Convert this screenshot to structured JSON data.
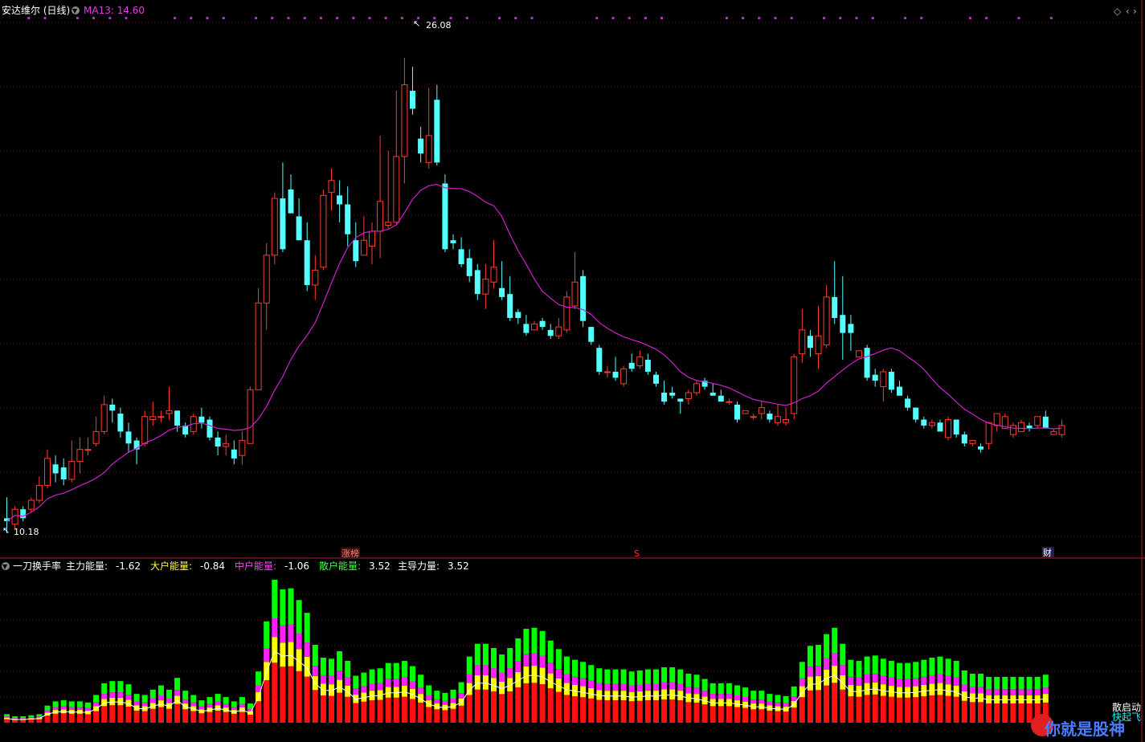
{
  "header": {
    "stock_title": "安达维尔 (日线)",
    "ma_label": "MA13: 14.60",
    "max_price_label": "26.08",
    "min_price_label": "10.18"
  },
  "markers": {
    "limit_up_tag": "涨榜",
    "s_tag": "S",
    "finance_tag": "财"
  },
  "sub_header": {
    "indicator_name": "一刀换手率",
    "items": [
      {
        "label": "主力能量:",
        "value": "-1.62",
        "color": "#ffffff"
      },
      {
        "label": "大户能量:",
        "value": "-0.84",
        "color": "#ffff40"
      },
      {
        "label": "中户能量:",
        "value": "-1.06",
        "color": "#ff40ff"
      },
      {
        "label": "散户能量:",
        "value": "3.52",
        "color": "#40ff40"
      },
      {
        "label": "主导力量:",
        "value": "3.52",
        "color": "#ffffff"
      }
    ]
  },
  "side_labels": [
    "散启动",
    "快起飞"
  ],
  "watermark": "你就是股神",
  "colors": {
    "up": "#ff3b2e",
    "down": "#54ffff",
    "ma": "#d020d0",
    "energy_red": "#ff1010",
    "energy_yellow": "#ffff00",
    "energy_magenta": "#ff20ff",
    "energy_green": "#00ff00"
  },
  "chart_data": [
    {
      "type": "candlestick",
      "title": "安达维尔 (日线)",
      "ylim": [
        9.5,
        27.5
      ],
      "candles": [
        [
          10.7,
          11.4,
          10.2,
          10.6
        ],
        [
          10.5,
          11.1,
          10.3,
          11.0
        ],
        [
          11.0,
          11.1,
          10.6,
          10.7
        ],
        [
          11.0,
          11.4,
          10.9,
          11.3
        ],
        [
          11.3,
          12.1,
          11.2,
          11.8
        ],
        [
          11.8,
          13.0,
          11.7,
          12.7
        ],
        [
          12.5,
          12.8,
          11.9,
          12.2
        ],
        [
          12.4,
          12.7,
          11.8,
          12.0
        ],
        [
          12.0,
          13.3,
          11.9,
          12.6
        ],
        [
          12.6,
          13.4,
          12.2,
          13.0
        ],
        [
          13.0,
          13.4,
          12.8,
          13.0
        ],
        [
          13.2,
          14.1,
          13.1,
          13.6
        ],
        [
          13.6,
          14.8,
          13.5,
          14.5
        ],
        [
          14.5,
          14.7,
          13.9,
          14.3
        ],
        [
          14.2,
          14.4,
          13.4,
          13.6
        ],
        [
          13.6,
          13.9,
          12.9,
          13.2
        ],
        [
          13.3,
          13.4,
          12.5,
          13.0
        ],
        [
          13.2,
          14.3,
          13.1,
          14.1
        ],
        [
          14.0,
          14.6,
          13.8,
          14.1
        ],
        [
          14.1,
          14.3,
          13.9,
          14.1
        ],
        [
          14.2,
          15.1,
          14.0,
          14.3
        ],
        [
          14.3,
          14.3,
          13.6,
          13.8
        ],
        [
          13.8,
          13.9,
          13.4,
          13.5
        ],
        [
          13.6,
          14.2,
          13.5,
          14.1
        ],
        [
          14.1,
          14.4,
          13.7,
          13.9
        ],
        [
          14.0,
          14.1,
          13.3,
          13.4
        ],
        [
          13.4,
          13.6,
          12.8,
          13.1
        ],
        [
          13.1,
          13.5,
          12.8,
          13.2
        ],
        [
          13.0,
          13.3,
          12.5,
          12.7
        ],
        [
          12.8,
          13.6,
          12.5,
          13.3
        ],
        [
          13.2,
          15.1,
          13.2,
          15.0
        ],
        [
          15.0,
          18.4,
          15.0,
          17.9
        ],
        [
          17.9,
          19.9,
          17.0,
          19.5
        ],
        [
          19.5,
          21.6,
          19.2,
          21.4
        ],
        [
          21.4,
          22.6,
          19.6,
          19.7
        ],
        [
          21.7,
          22.2,
          20.9,
          20.9
        ],
        [
          20.8,
          21.4,
          20.0,
          20.0
        ],
        [
          20.0,
          20.6,
          18.3,
          18.5
        ],
        [
          18.5,
          19.5,
          18.0,
          19.0
        ],
        [
          19.1,
          21.7,
          19.0,
          21.5
        ],
        [
          21.6,
          22.4,
          21.0,
          22.0
        ],
        [
          21.5,
          22.0,
          20.6,
          21.2
        ],
        [
          21.2,
          21.8,
          19.8,
          20.2
        ],
        [
          20.0,
          20.6,
          19.1,
          19.3
        ],
        [
          19.5,
          20.8,
          19.5,
          20.0
        ],
        [
          19.8,
          20.6,
          19.2,
          20.3
        ],
        [
          20.3,
          23.5,
          19.4,
          21.3
        ],
        [
          20.5,
          23.0,
          20.4,
          20.6
        ],
        [
          20.6,
          25.0,
          20.5,
          22.8
        ],
        [
          22.8,
          26.1,
          21.9,
          25.2
        ],
        [
          25.0,
          25.8,
          24.2,
          24.4
        ],
        [
          23.4,
          23.8,
          22.6,
          22.9
        ],
        [
          22.6,
          25.1,
          22.4,
          23.5
        ],
        [
          24.7,
          25.2,
          22.5,
          22.6
        ],
        [
          21.9,
          22.2,
          19.6,
          19.7
        ],
        [
          20.0,
          20.2,
          19.7,
          19.9
        ],
        [
          19.7,
          20.1,
          19.1,
          19.2
        ],
        [
          19.4,
          19.7,
          18.6,
          18.8
        ],
        [
          19.0,
          19.2,
          18.0,
          18.2
        ],
        [
          18.2,
          19.2,
          17.7,
          18.7
        ],
        [
          18.6,
          20.0,
          18.4,
          19.1
        ],
        [
          18.4,
          19.3,
          18.0,
          18.1
        ],
        [
          18.2,
          18.8,
          17.3,
          17.4
        ],
        [
          17.6,
          17.7,
          17.2,
          17.4
        ],
        [
          17.2,
          17.5,
          16.8,
          16.9
        ],
        [
          17.0,
          17.3,
          17.0,
          17.2
        ],
        [
          17.3,
          17.4,
          17.0,
          17.1
        ],
        [
          17.0,
          17.2,
          16.7,
          16.8
        ],
        [
          16.8,
          17.4,
          16.7,
          17.1
        ],
        [
          17.0,
          18.3,
          16.9,
          18.1
        ],
        [
          17.8,
          19.6,
          17.7,
          18.6
        ],
        [
          18.8,
          19.0,
          17.1,
          17.3
        ],
        [
          17.1,
          17.1,
          16.5,
          16.6
        ],
        [
          16.4,
          16.5,
          15.5,
          15.6
        ],
        [
          15.6,
          15.8,
          15.4,
          15.6
        ],
        [
          15.6,
          16.1,
          15.3,
          15.4
        ],
        [
          15.2,
          15.8,
          15.1,
          15.7
        ],
        [
          15.9,
          16.2,
          15.6,
          15.7
        ],
        [
          15.8,
          16.3,
          15.7,
          16.1
        ],
        [
          16.0,
          16.2,
          15.5,
          15.6
        ],
        [
          15.5,
          15.6,
          15.1,
          15.2
        ],
        [
          14.9,
          15.3,
          14.5,
          14.6
        ],
        [
          14.9,
          15.1,
          14.7,
          14.8
        ],
        [
          14.7,
          14.7,
          14.2,
          14.6
        ],
        [
          14.7,
          15.0,
          14.5,
          14.9
        ],
        [
          14.9,
          15.3,
          14.8,
          15.2
        ],
        [
          15.3,
          15.4,
          15.0,
          15.1
        ],
        [
          14.9,
          15.2,
          14.8,
          14.8
        ],
        [
          14.8,
          15.0,
          14.6,
          14.6
        ],
        [
          14.6,
          14.7,
          14.5,
          14.6
        ],
        [
          14.5,
          14.6,
          13.9,
          14.0
        ],
        [
          14.2,
          14.3,
          14.2,
          14.3
        ],
        [
          14.1,
          14.2,
          14.0,
          14.1
        ],
        [
          14.2,
          14.6,
          14.0,
          14.4
        ],
        [
          14.2,
          14.3,
          13.9,
          14.0
        ],
        [
          13.9,
          14.5,
          13.8,
          14.1
        ],
        [
          13.9,
          14.4,
          13.8,
          14.0
        ],
        [
          14.2,
          16.2,
          14.0,
          16.1
        ],
        [
          16.2,
          17.7,
          15.9,
          17.0
        ],
        [
          16.8,
          17.0,
          16.1,
          16.4
        ],
        [
          16.2,
          17.8,
          15.7,
          16.8
        ],
        [
          16.5,
          18.5,
          16.4,
          18.1
        ],
        [
          18.1,
          19.3,
          17.2,
          17.4
        ],
        [
          17.5,
          18.8,
          16.0,
          16.9
        ],
        [
          17.2,
          17.5,
          16.3,
          16.9
        ],
        [
          16.1,
          16.3,
          16.1,
          16.3
        ],
        [
          16.4,
          16.5,
          15.3,
          15.4
        ],
        [
          15.5,
          15.7,
          15.1,
          15.3
        ],
        [
          15.1,
          15.7,
          14.6,
          15.6
        ],
        [
          15.6,
          15.7,
          14.9,
          15.0
        ],
        [
          15.1,
          15.3,
          14.8,
          14.8
        ],
        [
          14.7,
          14.8,
          14.3,
          14.4
        ],
        [
          14.4,
          14.4,
          13.9,
          14.0
        ],
        [
          14.0,
          14.1,
          13.7,
          13.8
        ],
        [
          13.8,
          14.0,
          13.7,
          13.9
        ],
        [
          13.9,
          14.0,
          13.6,
          13.6
        ],
        [
          13.4,
          14.1,
          13.3,
          14.0
        ],
        [
          14.0,
          14.0,
          13.4,
          13.5
        ],
        [
          13.5,
          13.6,
          13.1,
          13.2
        ],
        [
          13.2,
          13.3,
          13.1,
          13.3
        ],
        [
          13.1,
          13.2,
          12.9,
          13.0
        ],
        [
          13.2,
          13.9,
          13.0,
          13.9
        ],
        [
          13.8,
          14.2,
          13.6,
          14.2
        ],
        [
          13.7,
          14.2,
          13.7,
          14.1
        ],
        [
          13.5,
          13.9,
          13.4,
          13.8
        ],
        [
          13.6,
          14.0,
          13.6,
          13.9
        ],
        [
          13.8,
          13.9,
          13.6,
          13.7
        ],
        [
          13.8,
          14.1,
          13.7,
          14.1
        ],
        [
          14.1,
          14.3,
          13.7,
          13.7
        ],
        [
          13.5,
          13.7,
          13.5,
          13.6
        ],
        [
          13.5,
          14.0,
          13.4,
          13.8
        ]
      ]
    },
    {
      "type": "stacked-bar",
      "title": "一刀换手率",
      "series": [
        {
          "name": "主力能量",
          "values": []
        },
        {
          "name": "大户能量",
          "values": []
        },
        {
          "name": "中户能量",
          "values": []
        },
        {
          "name": "散户能量",
          "values": []
        }
      ],
      "bar_totals": [
        0.8,
        0.6,
        0.6,
        0.7,
        0.8,
        1.6,
        2.0,
        2.1,
        2.0,
        2.0,
        1.9,
        2.6,
        3.7,
        3.9,
        3.9,
        3.6,
        2.7,
        2.6,
        3.1,
        3.5,
        3.1,
        4.2,
        3.0,
        2.6,
        2.1,
        2.4,
        2.7,
        2.4,
        2.0,
        2.4,
        1.8,
        4.8,
        9.5,
        13.4,
        12.5,
        12.6,
        11.5,
        10.3,
        7.3,
        6.1,
        6.0,
        6.7,
        5.8,
        4.4,
        4.7,
        5.0,
        5.1,
        5.6,
        5.6,
        5.8,
        5.3,
        4.5,
        3.5,
        3.0,
        2.8,
        3.1,
        3.8,
        6.2,
        7.4,
        7.4,
        7.0,
        6.4,
        7.0,
        7.9,
        8.8,
        8.9,
        8.6,
        7.7,
        6.9,
        6.2,
        5.9,
        5.7,
        5.4,
        5.1,
        5.0,
        5.0,
        5.0,
        4.8,
        4.9,
        5.0,
        5.0,
        5.2,
        5.2,
        5.0,
        4.6,
        4.5,
        4.1,
        3.7,
        3.7,
        3.7,
        3.5,
        3.3,
        3.0,
        3.0,
        2.7,
        2.6,
        2.5,
        3.4,
        5.7,
        7.2,
        7.3,
        8.3,
        8.9,
        7.4,
        5.9,
        5.8,
        6.2,
        6.3,
        6.0,
        5.8,
        5.6,
        5.6,
        5.7,
        5.9,
        6.1,
        6.2,
        6.0,
        5.8,
        4.9,
        4.6,
        4.6,
        4.3,
        4.3,
        4.3,
        4.3,
        4.3,
        4.3,
        4.3,
        4.5
      ]
    }
  ]
}
